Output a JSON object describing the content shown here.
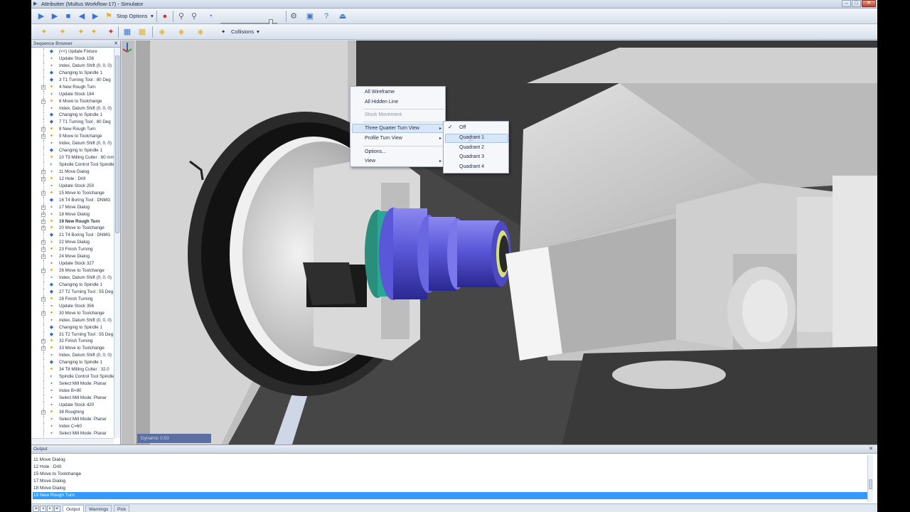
{
  "window": {
    "title": "Attributter (Multus Workflow-17) - Simulator",
    "controls": {
      "minimize": "–",
      "maximize": "□",
      "close": "✕"
    }
  },
  "toolbar": {
    "stop_options_label": "Stop Options",
    "collisions_label": "Collisions",
    "icons": [
      "play-icon",
      "step-icon",
      "stop-icon",
      "rewind-icon",
      "forward-icon",
      "stop-options-icon",
      "record-icon",
      "zoom-icon",
      "binoculars-icon",
      "speed-icon",
      "save-settings-icon",
      "save-icon",
      "help-icon",
      "eject-icon"
    ]
  },
  "sequence_browser": {
    "title": "Sequence Browser",
    "items": [
      {
        "label": "(<<) Update Fixture",
        "icon": "c-blue",
        "exp": false
      },
      {
        "label": "Update Stock 156",
        "icon": "c-gray",
        "exp": false
      },
      {
        "label": "Index, Datum Shift (0, 0, 0)",
        "icon": "c-gray",
        "exp": false
      },
      {
        "label": "Changing to Spindle 1",
        "icon": "c-blue",
        "exp": false
      },
      {
        "label": "3 T1 Turning Tool : 80 Deg",
        "icon": "c-blue",
        "exp": false
      },
      {
        "label": "4 New Rough Turn",
        "icon": "c-gold",
        "exp": true
      },
      {
        "label": "Update Stock 184",
        "icon": "c-gray",
        "exp": false
      },
      {
        "label": "6 Move to Toolchange",
        "icon": "c-gold",
        "exp": true
      },
      {
        "label": "Index, Datum Shift (0, 0, 0)",
        "icon": "c-gray",
        "exp": false
      },
      {
        "label": "Changing to Spindle 1",
        "icon": "c-blue",
        "exp": false
      },
      {
        "label": "7 T1 Turning Tool : 80 Deg",
        "icon": "c-blue",
        "exp": false
      },
      {
        "label": "8 New Rough Turn",
        "icon": "c-gold",
        "exp": true
      },
      {
        "label": "9 Move to Toolchange",
        "icon": "c-gold",
        "exp": true
      },
      {
        "label": "Index, Datum Shift (0, 0, 0)",
        "icon": "c-gray",
        "exp": false
      },
      {
        "label": "Changing to Spindle 1",
        "icon": "c-blue",
        "exp": false
      },
      {
        "label": "10 T9 Milling Cutter : 60 mm",
        "icon": "c-gold",
        "exp": false
      },
      {
        "label": "Spindle Control Tool Spindle",
        "icon": "c-teal",
        "exp": false
      },
      {
        "label": "11 Move Dialog",
        "icon": "c-gray",
        "exp": true
      },
      {
        "label": "12 Hole : Drill",
        "icon": "c-gold",
        "exp": true
      },
      {
        "label": "Update Stock 250",
        "icon": "c-gray",
        "exp": false
      },
      {
        "label": "15 Move to Toolchange",
        "icon": "c-gold",
        "exp": true
      },
      {
        "label": "16 T4 Boring Tool : DNMG",
        "icon": "c-blue",
        "exp": false
      },
      {
        "label": "17 Move Dialog",
        "icon": "c-gray",
        "exp": true
      },
      {
        "label": "18 Move Dialog",
        "icon": "c-gray",
        "exp": true
      },
      {
        "label": "19 New Rough Turn",
        "icon": "c-gold",
        "exp": true,
        "bold": true
      },
      {
        "label": "20 Move to Toolchange",
        "icon": "c-gold",
        "exp": true
      },
      {
        "label": "21 T4 Boring Tool : DNMG",
        "icon": "c-blue",
        "exp": false
      },
      {
        "label": "22 Move Dialog",
        "icon": "c-gray",
        "exp": true
      },
      {
        "label": "23 Finish Turning",
        "icon": "c-gold",
        "exp": true
      },
      {
        "label": "24 Move Dialog",
        "icon": "c-gray",
        "exp": true
      },
      {
        "label": "Update Stock 327",
        "icon": "c-gray",
        "exp": false
      },
      {
        "label": "26 Move to Toolchange",
        "icon": "c-gold",
        "exp": true
      },
      {
        "label": "Index, Datum Shift (0, 0, 0)",
        "icon": "c-gray",
        "exp": false
      },
      {
        "label": "Changing to Spindle 1",
        "icon": "c-blue",
        "exp": false
      },
      {
        "label": "27 T2 Turning Tool : 55 Deg",
        "icon": "c-blue",
        "exp": false
      },
      {
        "label": "28 Finish Turning",
        "icon": "c-gold",
        "exp": true
      },
      {
        "label": "Update Stock 356",
        "icon": "c-gray",
        "exp": false
      },
      {
        "label": "30 Move to Toolchange",
        "icon": "c-gold",
        "exp": true
      },
      {
        "label": "Index, Datum Shift (0, 0, 0)",
        "icon": "c-gray",
        "exp": false
      },
      {
        "label": "Changing to Spindle 1",
        "icon": "c-blue",
        "exp": false
      },
      {
        "label": "31 T2 Turning Tool : 55 Deg",
        "icon": "c-blue",
        "exp": false
      },
      {
        "label": "32 Finish Turning",
        "icon": "c-gold",
        "exp": true
      },
      {
        "label": "33 Move to Toolchange",
        "icon": "c-gold",
        "exp": true
      },
      {
        "label": "Index, Datum Shift (0, 0, 0)",
        "icon": "c-gray",
        "exp": false
      },
      {
        "label": "Changing to Spindle 1",
        "icon": "c-blue",
        "exp": false
      },
      {
        "label": "34 T8 Milling Cutter : 32.0",
        "icon": "c-gold",
        "exp": false
      },
      {
        "label": "Spindle Control Tool Spindle",
        "icon": "c-teal",
        "exp": false
      },
      {
        "label": "Select Mill Mode: Planar",
        "icon": "c-gray",
        "exp": false
      },
      {
        "label": "Index B=90",
        "icon": "c-gray",
        "exp": false
      },
      {
        "label": "Select Mill Mode: Planar",
        "icon": "c-gray",
        "exp": false
      },
      {
        "label": "Update Stock 420",
        "icon": "c-gray",
        "exp": false
      },
      {
        "label": "38 Roughing",
        "icon": "c-gold",
        "exp": true
      },
      {
        "label": "Select Mill Mode: Planar",
        "icon": "c-gray",
        "exp": false
      },
      {
        "label": "Index C=60",
        "icon": "c-gray",
        "exp": false
      },
      {
        "label": "Select Mill Mode: Planar",
        "icon": "c-gray",
        "exp": false
      }
    ]
  },
  "context_menu": {
    "items": [
      {
        "label": "All Wireframe",
        "disabled": false,
        "submenu": false
      },
      {
        "label": "All Hidden Line",
        "disabled": false,
        "submenu": false
      },
      {
        "label": "Stock Movement",
        "disabled": true,
        "submenu": false
      },
      {
        "label": "Three Quarter Turn View",
        "disabled": false,
        "submenu": true
      },
      {
        "label": "Profile Turn View",
        "disabled": false,
        "submenu": true
      },
      {
        "label": "Options...",
        "disabled": false,
        "submenu": false
      },
      {
        "label": "View",
        "disabled": false,
        "submenu": true
      }
    ],
    "submenu_arrow": "▸",
    "submenu": {
      "checked_mark": "✓",
      "items": [
        "Off",
        "Quadrant 1",
        "Quadrant 2",
        "Quadrant 3",
        "Quadrant 4"
      ],
      "checked_item": "Off",
      "hovered_item": "Quadrant 1"
    }
  },
  "viewport": {
    "status_text": "Dynamic 0.53"
  },
  "output": {
    "title": "Output",
    "close_glyph": "✕",
    "lines": [
      "11 Move Dialog",
      "12 Hole : Drill",
      "15 Move to Toolchange",
      "17 Move Dialog",
      "18 Move Dialog",
      "19 New Rough Turn"
    ],
    "selected_line": "19 New Rough Turn",
    "tabs": [
      "Output",
      "Warnings",
      "Pick"
    ],
    "active_tab": "Output",
    "nav_glyphs": [
      "|◂",
      "◂",
      "▸",
      "▸|"
    ]
  },
  "colors": {
    "accent": "#3399ff",
    "part_blue": "#5855d6",
    "part_teal": "#2aa896",
    "machine_gray": "#c9c9c9"
  }
}
